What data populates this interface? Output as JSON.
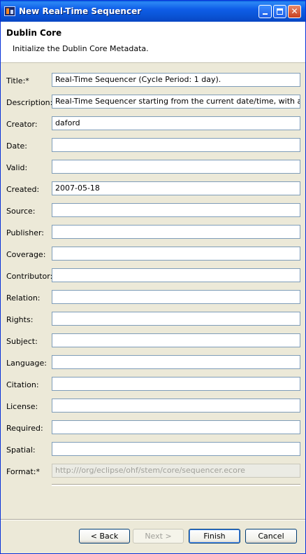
{
  "window": {
    "title": "New Real-Time Sequencer",
    "minimize_label": "",
    "maximize_label": "",
    "close_label": "✕"
  },
  "header": {
    "title": "Dublin Core",
    "description": "Initialize the Dublin Core Metadata."
  },
  "fields": [
    {
      "label": "Title:*",
      "value": "Real-Time Sequencer (Cycle Period: 1 day)."
    },
    {
      "label": "Description:",
      "value": "Real-Time Sequencer starting from the current date/time, with a cycle pe"
    },
    {
      "label": "Creator:",
      "value": "daford"
    },
    {
      "label": "Date:",
      "value": ""
    },
    {
      "label": "Valid:",
      "value": ""
    },
    {
      "label": "Created:",
      "value": "2007-05-18"
    },
    {
      "label": "Source:",
      "value": ""
    },
    {
      "label": "Publisher:",
      "value": ""
    },
    {
      "label": "Coverage:",
      "value": ""
    },
    {
      "label": "Contributor:",
      "value": ""
    },
    {
      "label": "Relation:",
      "value": ""
    },
    {
      "label": "Rights:",
      "value": ""
    },
    {
      "label": "Subject:",
      "value": ""
    },
    {
      "label": "Language:",
      "value": ""
    },
    {
      "label": "Citation:",
      "value": ""
    },
    {
      "label": "License:",
      "value": ""
    },
    {
      "label": "Required:",
      "value": ""
    },
    {
      "label": "Spatial:",
      "value": ""
    },
    {
      "label": "Format:*",
      "value": "http:///org/eclipse/ohf/stem/core/sequencer.ecore"
    }
  ],
  "buttons": {
    "back": "< Back",
    "next": "Next >",
    "finish": "Finish",
    "cancel": "Cancel"
  }
}
